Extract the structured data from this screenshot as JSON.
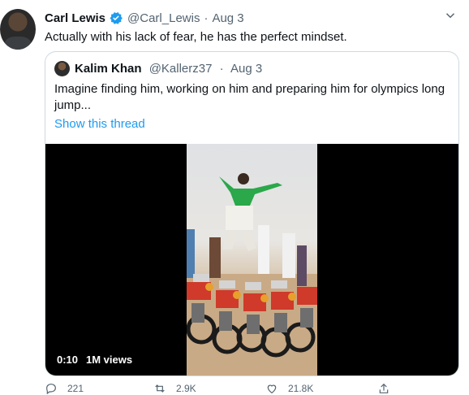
{
  "tweet": {
    "author_name": "Carl Lewis",
    "author_handle": "@Carl_Lewis",
    "separator": "·",
    "date": "Aug 3",
    "text": "Actually with his lack of fear, he has the perfect mindset."
  },
  "quoted": {
    "author_name": "Kalim Khan",
    "author_handle": "@Kallerz37",
    "separator": "·",
    "date": "Aug 3",
    "text": "Imagine finding him, working on him and preparing him for olympics long jump...",
    "thread_link": "Show this thread",
    "video": {
      "time": "0:10",
      "views": "1M views"
    }
  },
  "actions": {
    "reply_count": "221",
    "retweet_count": "2.9K",
    "like_count": "21.8K"
  },
  "colors": {
    "link": "#1d9bf0",
    "muted": "#536471",
    "border": "#cfd9de"
  },
  "icons": [
    "verified-badge-icon",
    "chevron-down-icon",
    "reply-icon",
    "retweet-icon",
    "like-icon",
    "share-icon"
  ]
}
